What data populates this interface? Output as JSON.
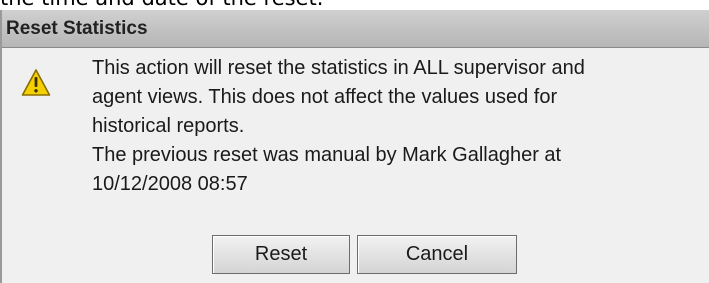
{
  "page_context": {
    "partial_text": "the time and date of the reset."
  },
  "dialog": {
    "title": "Reset Statistics",
    "icon": "warning-icon",
    "message_lines": [
      "This action will reset the statistics in ALL supervisor and",
      "agent views. This does not affect the values used for",
      "historical reports.",
      "The previous reset was manual by Mark Gallagher at",
      "10/12/2008 08:57"
    ],
    "buttons": {
      "reset_label": "Reset",
      "cancel_label": "Cancel"
    }
  },
  "colors": {
    "title_bar": "#c4c4c4",
    "dialog_background": "#f0f0f0",
    "warning_fill": "#f5d000",
    "warning_stroke": "#8a6d00"
  }
}
